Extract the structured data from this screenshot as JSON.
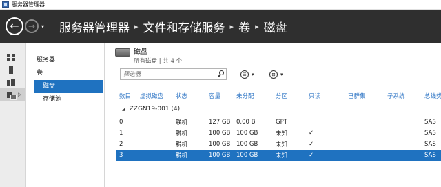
{
  "window": {
    "title": "服务器管理器"
  },
  "header": {
    "back_glyph": "←",
    "forward_glyph": "→",
    "dropdown_glyph": "▾",
    "breadcrumb": [
      "服务器管理器",
      "文件和存储服务",
      "卷",
      "磁盘"
    ],
    "separator": "▸"
  },
  "rail": {
    "items": [
      {
        "icon": "dashboard-icon"
      },
      {
        "icon": "local-server-icon"
      },
      {
        "icon": "all-servers-icon"
      },
      {
        "icon": "file-storage-icon",
        "arrow": "▷"
      }
    ]
  },
  "subnav": {
    "items": [
      {
        "label": "服务器"
      },
      {
        "label": "卷"
      },
      {
        "label": "磁盘"
      },
      {
        "label": "存储池"
      }
    ]
  },
  "panel": {
    "title": "磁盘",
    "subtitle": "所有磁盘 | 共 4 个",
    "filter_placeholder": "筛选器",
    "list_icon_glyph": "☰",
    "group_icon_glyph": "⊞",
    "caret": "▾"
  },
  "table": {
    "columns": [
      "数目",
      "虚拟磁盘",
      "状态",
      "容量",
      "未分配",
      "分区",
      "只读",
      "已群集",
      "子系统",
      "总线类型"
    ],
    "group": {
      "label": "ZZGN19-001 (4)",
      "toggle": "◢"
    },
    "rows": [
      [
        "0",
        "",
        "联机",
        "127 GB",
        "0.00 B",
        "GPT",
        "",
        "",
        "",
        "SAS"
      ],
      [
        "1",
        "",
        "脱机",
        "100 GB",
        "100 GB",
        "未知",
        "✓",
        "",
        "",
        "SAS"
      ],
      [
        "2",
        "",
        "脱机",
        "100 GB",
        "100 GB",
        "未知",
        "✓",
        "",
        "",
        "SAS"
      ],
      [
        "3",
        "",
        "脱机",
        "100 GB",
        "100 GB",
        "未知",
        "✓",
        "",
        "",
        "SAS"
      ]
    ],
    "selected_row": 3
  },
  "colors": {
    "header_bg": "#2f2f2f",
    "selection": "#1f72c0",
    "column_header_text": "#2e75c5"
  }
}
